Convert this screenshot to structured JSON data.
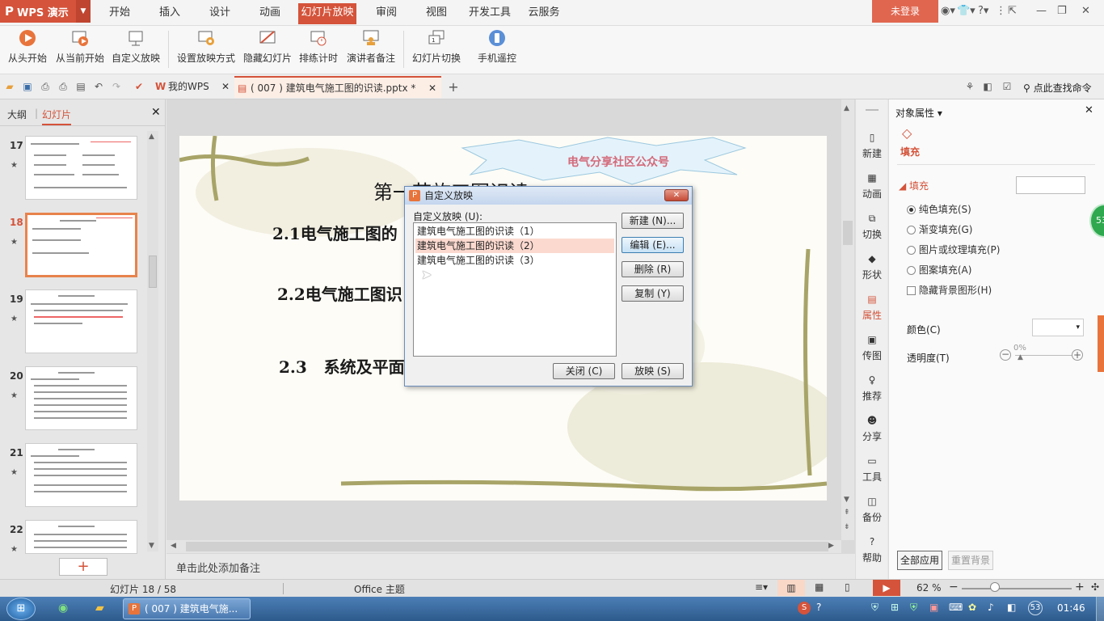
{
  "app": {
    "name": "WPS 演示",
    "logo": "P"
  },
  "menu_tabs": [
    "开始",
    "插入",
    "设计",
    "动画",
    "幻灯片放映",
    "审阅",
    "视图",
    "开发工具",
    "云服务"
  ],
  "active_menu_tab": "幻灯片放映",
  "login_label": "未登录",
  "ribbon": {
    "buttons": [
      "从头开始",
      "从当前开始",
      "自定义放映",
      "设置放映方式",
      "隐藏幻灯片",
      "排练计时",
      "演讲者备注",
      "幻灯片切换",
      "手机遥控"
    ]
  },
  "doc_tabs": [
    {
      "label": "我的WPS"
    },
    {
      "label": "( 007 ) 建筑电气施工图的识读.pptx *"
    }
  ],
  "search_command_label": "点此查找命令",
  "left_panel": {
    "tabs": [
      "大纲",
      "幻灯片"
    ],
    "slide_numbers": [
      "17",
      "18",
      "19",
      "20",
      "21",
      "22"
    ],
    "selected_slide": "18"
  },
  "slide": {
    "title": "第一节施工图识读",
    "banner": "电气分享社区公众号",
    "items": [
      "2.1电气施工图的",
      "2.2电气施工图识",
      "2.3   系统及平面"
    ]
  },
  "notes_placeholder": "单击此处添加备注",
  "dialog": {
    "title": "自定义放映",
    "list_label": "自定义放映 (U):",
    "items": [
      "建筑电气施工图的识读（1）",
      "建筑电气施工图的识读（2）",
      "建筑电气施工图的识读（3）"
    ],
    "selected_index": 1,
    "buttons": {
      "new": "新建 (N)...",
      "edit": "编辑 (E)...",
      "delete": "删除 (R)",
      "copy": "复制 (Y)",
      "close": "关闭 (C)",
      "show": "放映 (S)"
    }
  },
  "right_bar": [
    "新建",
    "动画",
    "切换",
    "形状",
    "属性",
    "传图",
    "推荐",
    "分享",
    "工具",
    "备份",
    "帮助"
  ],
  "properties": {
    "title": "对象属性",
    "tab": "填充",
    "section": "填充",
    "options": [
      "纯色填充(S)",
      "渐变填充(G)",
      "图片或纹理填充(P)",
      "图案填充(A)"
    ],
    "selected_option": "纯色填充(S)",
    "hide_bg_label": "隐藏背景图形(H)",
    "color_label": "颜色(C)",
    "transparency_label": "透明度(T)",
    "transparency_value": "0%",
    "apply_all": "全部应用",
    "reset_bg": "重置背景",
    "floating_badge": "53"
  },
  "status": {
    "slide_info": "幻灯片 18 / 58",
    "theme": "Office 主题",
    "zoom": "62 %"
  },
  "taskbar": {
    "task_label": "( 007 ) 建筑电气施...",
    "clock": "01:46",
    "tray_badge": "53"
  },
  "colors": {
    "accent": "#d4533a",
    "selected_thumb": "#e8834d",
    "list_selection": "#fbd9cf"
  }
}
